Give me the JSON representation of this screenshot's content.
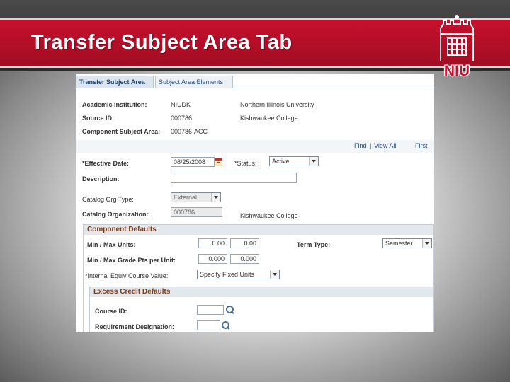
{
  "slide": {
    "title": "Transfer Subject Area Tab"
  },
  "logo": {
    "text": "NIU"
  },
  "tabs": [
    {
      "label": "Transfer Subject Area"
    },
    {
      "label": "Subject Area Elements"
    }
  ],
  "header": {
    "academic_institution_label": "Academic Institution:",
    "academic_institution_code": "NIUDK",
    "academic_institution_name": "Northern Illinois University",
    "source_id_label": "Source ID:",
    "source_id_code": "000786",
    "source_id_name": "Kishwaukee College",
    "component_subject_area_label": "Component Subject Area:",
    "component_subject_area_value": "000786-ACC"
  },
  "grid_nav": {
    "find": "Find",
    "separator": "|",
    "view_all": "View All",
    "first": "First"
  },
  "form": {
    "effective_date_label": "*Effective Date:",
    "effective_date_value": "08/25/2008",
    "status_label": "*Status:",
    "status_value": "Active",
    "description_label": "Description:",
    "description_value": "",
    "catalog_org_type_label": "Catalog Org Type:",
    "catalog_org_type_value": "External",
    "catalog_organization_label": "Catalog Organization:",
    "catalog_organization_value": "000786",
    "catalog_organization_name": "Kishwaukee College"
  },
  "component_defaults": {
    "title": "Component Defaults",
    "min_max_units_label": "Min / Max Units:",
    "min_units": "0.00",
    "max_units": "0.00",
    "term_type_label": "Term Type:",
    "term_type_value": "Semester",
    "min_max_grade_pts_label": "Min / Max Grade Pts per Unit:",
    "min_grade_pts": "0.000",
    "max_grade_pts": "0.000",
    "internal_equiv_label": "*Internal Equiv Course Value:",
    "internal_equiv_value": "Specify Fixed Units"
  },
  "excess_credit": {
    "title": "Excess Credit Defaults",
    "course_id_label": "Course ID:",
    "course_id_value": "",
    "requirement_designation_label": "Requirement Designation:",
    "requirement_designation_value": ""
  }
}
